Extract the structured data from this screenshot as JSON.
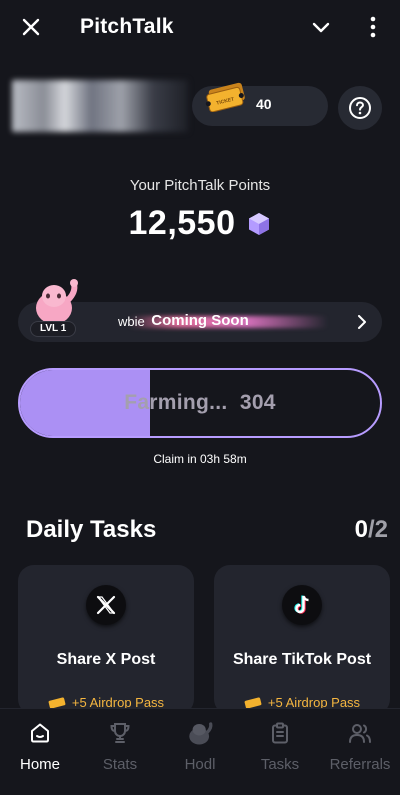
{
  "header": {
    "title": "PitchTalk",
    "close_icon": "close-icon",
    "chevron_icon": "chevron-down-icon",
    "menu_icon": "kebab-menu-icon"
  },
  "profile": {
    "ticket_count": "40",
    "ticket_icon": "ticket-icon",
    "ticket_text": "TICKET",
    "help_icon": "help-icon"
  },
  "points": {
    "label": "Your PitchTalk Points",
    "value": "12,550",
    "icon": "purple-gem-icon"
  },
  "level": {
    "name": "wbie",
    "status": "Coming Soon",
    "badge": "LVL 1",
    "arrow_icon": "chevron-right-icon"
  },
  "farming": {
    "label": "Farming...",
    "value": "304",
    "progress": 0.36,
    "claim_text": "Claim in 03h 58m",
    "fill_color": "#ab90f4",
    "border_color": "#b79cff"
  },
  "daily_tasks": {
    "title": "Daily Tasks",
    "done": "0",
    "total": "/2",
    "items": [
      {
        "name": "Share X Post",
        "reward": "+5 Airdrop Pass",
        "icon": "x-logo-icon"
      },
      {
        "name": "Share TikTok Post",
        "reward": "+5 Airdrop Pass",
        "icon": "tiktok-logo-icon"
      }
    ]
  },
  "nav": {
    "items": [
      {
        "label": "Home",
        "icon": "home-icon",
        "active": true
      },
      {
        "label": "Stats",
        "icon": "trophy-icon",
        "active": false
      },
      {
        "label": "Hodl",
        "icon": "hodl-mascot-icon",
        "active": false
      },
      {
        "label": "Tasks",
        "icon": "clipboard-icon",
        "active": false
      },
      {
        "label": "Referrals",
        "icon": "users-icon",
        "active": false
      }
    ]
  }
}
